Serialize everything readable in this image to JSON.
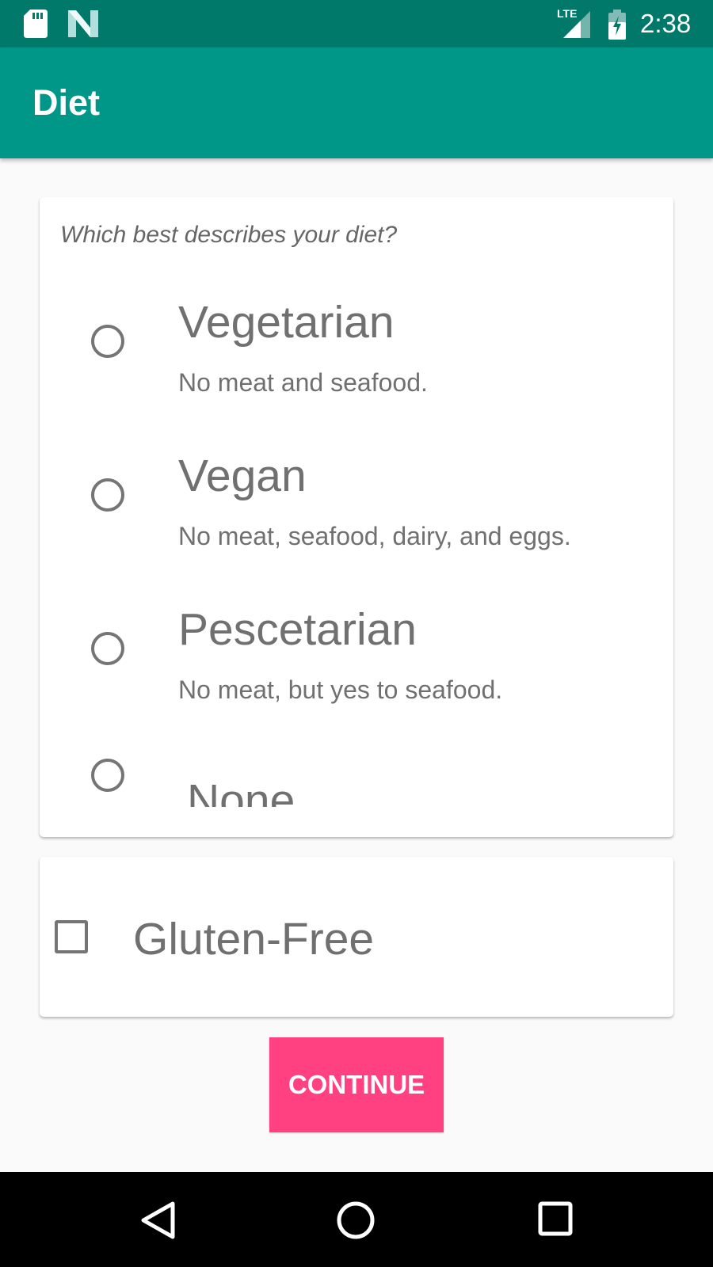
{
  "status_bar": {
    "time": "2:38",
    "network_label": "LTE",
    "icons": [
      "sd-card-icon",
      "n-logo-icon",
      "lte-signal-icon",
      "battery-charging-icon"
    ]
  },
  "app_bar": {
    "title": "Diet"
  },
  "diet_card": {
    "question": "Which best describes your diet?",
    "options": [
      {
        "title": "Vegetarian",
        "description": "No meat and seafood.",
        "selected": false
      },
      {
        "title": "Vegan",
        "description": "No meat, seafood, dairy, and eggs.",
        "selected": false
      },
      {
        "title": "Pescetarian",
        "description": "No meat, but yes to seafood.",
        "selected": false
      },
      {
        "title": "None",
        "selected": false
      }
    ]
  },
  "gluten_card": {
    "label": "Gluten-Free",
    "checked": false
  },
  "continue_button": {
    "label": "CONTINUE",
    "color": "#ff4081"
  },
  "colors": {
    "status_bar": "#00796b",
    "app_bar": "#009688",
    "accent": "#ff4081",
    "background": "#fafafa"
  },
  "nav_bar": {
    "icons": [
      "back-icon",
      "home-icon",
      "recents-icon"
    ]
  }
}
